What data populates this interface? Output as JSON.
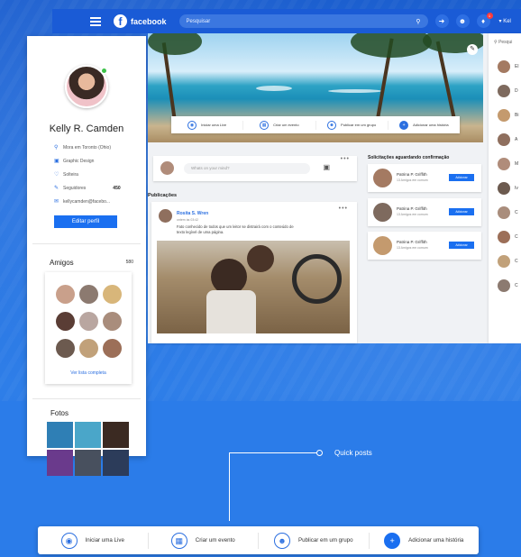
{
  "topbar": {
    "brand": "facebook",
    "search_placeholder": "Pesquisar",
    "notification_count": "1",
    "user_short": "Kel"
  },
  "profile": {
    "name": "Kelly R. Camden",
    "info": [
      {
        "icon": "location-icon",
        "text": "Mora em Toronto (Ohio)"
      },
      {
        "icon": "work-icon",
        "text": "Graphic Design"
      },
      {
        "icon": "heart-icon",
        "text": "Solteira"
      },
      {
        "icon": "followers-icon",
        "text": "Seguidores",
        "count": "450"
      },
      {
        "icon": "mail-icon",
        "text": "kellycamden@facebo..."
      }
    ],
    "edit_label": "Editar perfil"
  },
  "friends": {
    "title": "Amigos",
    "count": "580",
    "see_all": "Ver lista completa",
    "avatar_colors": [
      "#c9a08b",
      "#8c7a70",
      "#d8b67a",
      "#5a3d35",
      "#b9a6a0",
      "#a98d7c",
      "#6c5a4f",
      "#c1a17a",
      "#9c6f58"
    ]
  },
  "photos": {
    "title": "Fotos",
    "colors": [
      "#2f7fb5",
      "#4aa6c9",
      "#3b2a22",
      "#6a3a8c",
      "#48505e",
      "#2c3c5a"
    ]
  },
  "composer": {
    "placeholder": "Whats on your mind?"
  },
  "publications": {
    "label": "Publicações",
    "post": {
      "author": "Rosita S. Wren",
      "time": "ontem às 03:42",
      "text": "Fato conhecido de todos que um leitor se distrairá com o conteúdo de texto legível de uma página."
    }
  },
  "requests": {
    "title": "Solicitações aguardando confirmação",
    "items": [
      {
        "name": "Patrina P. Griffith",
        "sub": "13 Amigos em comum",
        "button": "Adicionar"
      },
      {
        "name": "Patrina P. Griffith",
        "sub": "13 Amigos em comum",
        "button": "Adicionar"
      },
      {
        "name": "Patrina P. Griffith",
        "sub": "13 Amigos em comum",
        "button": "Adicionar"
      }
    ]
  },
  "right_column": {
    "search_label": "Pesqui",
    "contacts": [
      "El",
      "D",
      "Bi",
      "A",
      "M",
      "Iv",
      "C",
      "C",
      "C",
      "C"
    ]
  },
  "quick_actions": [
    {
      "icon": "live-icon",
      "label": "Iniciar uma Live"
    },
    {
      "icon": "calendar-icon",
      "label": "Criar um evento"
    },
    {
      "icon": "group-icon",
      "label": "Publicar em um grupo"
    },
    {
      "icon": "plus-icon",
      "label": "Adicionar uma história"
    }
  ],
  "callout": {
    "label": "Quick posts"
  }
}
